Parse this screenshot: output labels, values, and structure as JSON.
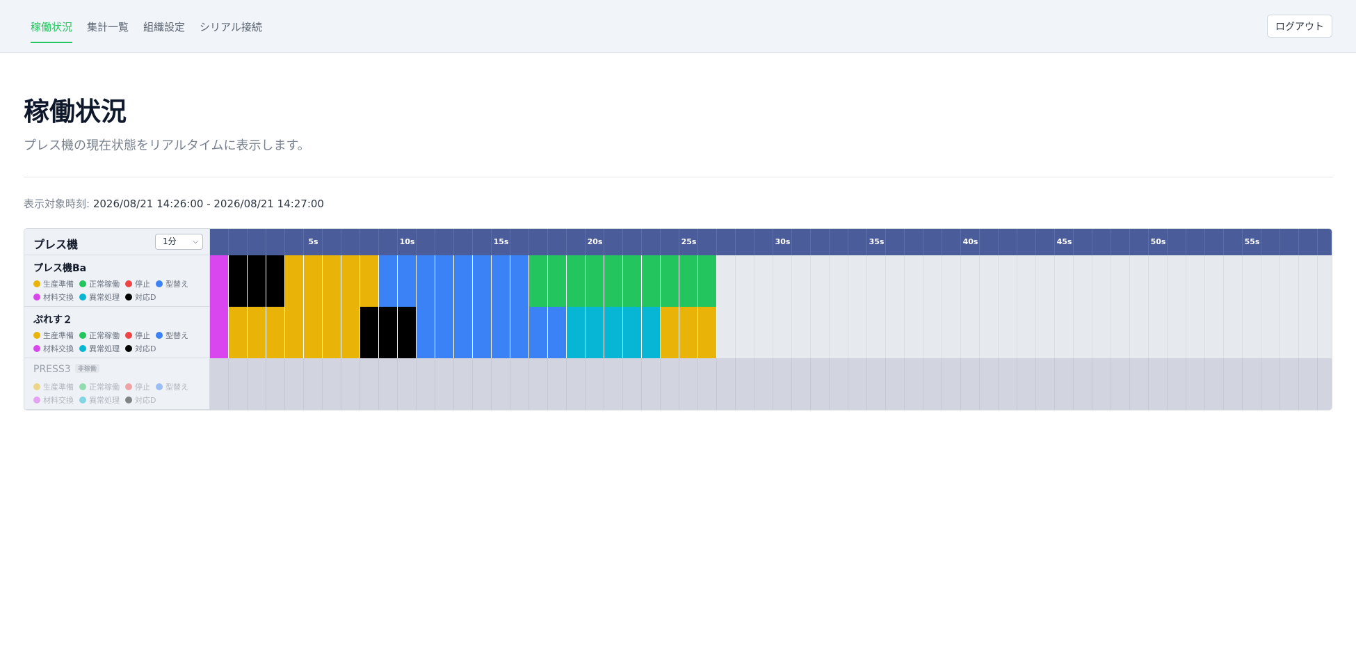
{
  "nav": {
    "items": [
      {
        "label": "稼働状況",
        "active": true
      },
      {
        "label": "集計一覧",
        "active": false
      },
      {
        "label": "組織設定",
        "active": false
      },
      {
        "label": "シリアル接続",
        "active": false
      }
    ],
    "logout_label": "ログアウト"
  },
  "page": {
    "title": "稼働状況",
    "subtitle": "プレス機の現在状態をリアルタイムに表示します。",
    "range_label": "表示対象時刻:",
    "range_value": "2026/08/21 14:26:00 - 2026/08/21 14:27:00"
  },
  "board": {
    "title": "プレス機",
    "period_value": "1分",
    "time_labels": [
      "5s",
      "10s",
      "15s",
      "20s",
      "25s",
      "30s",
      "35s",
      "40s",
      "45s",
      "50s",
      "55s"
    ]
  },
  "status_colors": {
    "prep": "#eab308",
    "normal": "#22c55e",
    "stop": "#ef4444",
    "change": "#3b82f6",
    "material": "#d946ef",
    "abnormal": "#06b6d4",
    "response": "#000000"
  },
  "legend": [
    {
      "key": "prep",
      "label": "生産準備"
    },
    {
      "key": "normal",
      "label": "正常稼働"
    },
    {
      "key": "stop",
      "label": "停止"
    },
    {
      "key": "change",
      "label": "型替え"
    },
    {
      "key": "material",
      "label": "材料交換"
    },
    {
      "key": "abnormal",
      "label": "異常処理"
    },
    {
      "key": "response",
      "label": "対応D"
    }
  ],
  "machines": [
    {
      "name": "プレス機Ba",
      "active": true,
      "badge": "",
      "seconds": [
        "material",
        "response",
        "response",
        "response",
        "prep",
        "prep",
        "prep",
        "prep",
        "prep",
        "change",
        "change",
        "change",
        "change",
        "change",
        "change",
        "change",
        "change",
        "normal",
        "normal",
        "normal",
        "normal",
        "normal",
        "normal",
        "normal",
        "normal",
        "normal",
        "normal"
      ]
    },
    {
      "name": "ぷれす２",
      "active": true,
      "badge": "",
      "seconds": [
        "material",
        "prep",
        "prep",
        "prep",
        "prep",
        "prep",
        "prep",
        "prep",
        "response",
        "response",
        "response",
        "change",
        "change",
        "change",
        "change",
        "change",
        "change",
        "change",
        "change",
        "abnormal",
        "abnormal",
        "abnormal",
        "abnormal",
        "abnormal",
        "prep",
        "prep",
        "prep"
      ]
    },
    {
      "name": "PRESS3",
      "active": false,
      "badge": "非稼働",
      "seconds": []
    }
  ]
}
